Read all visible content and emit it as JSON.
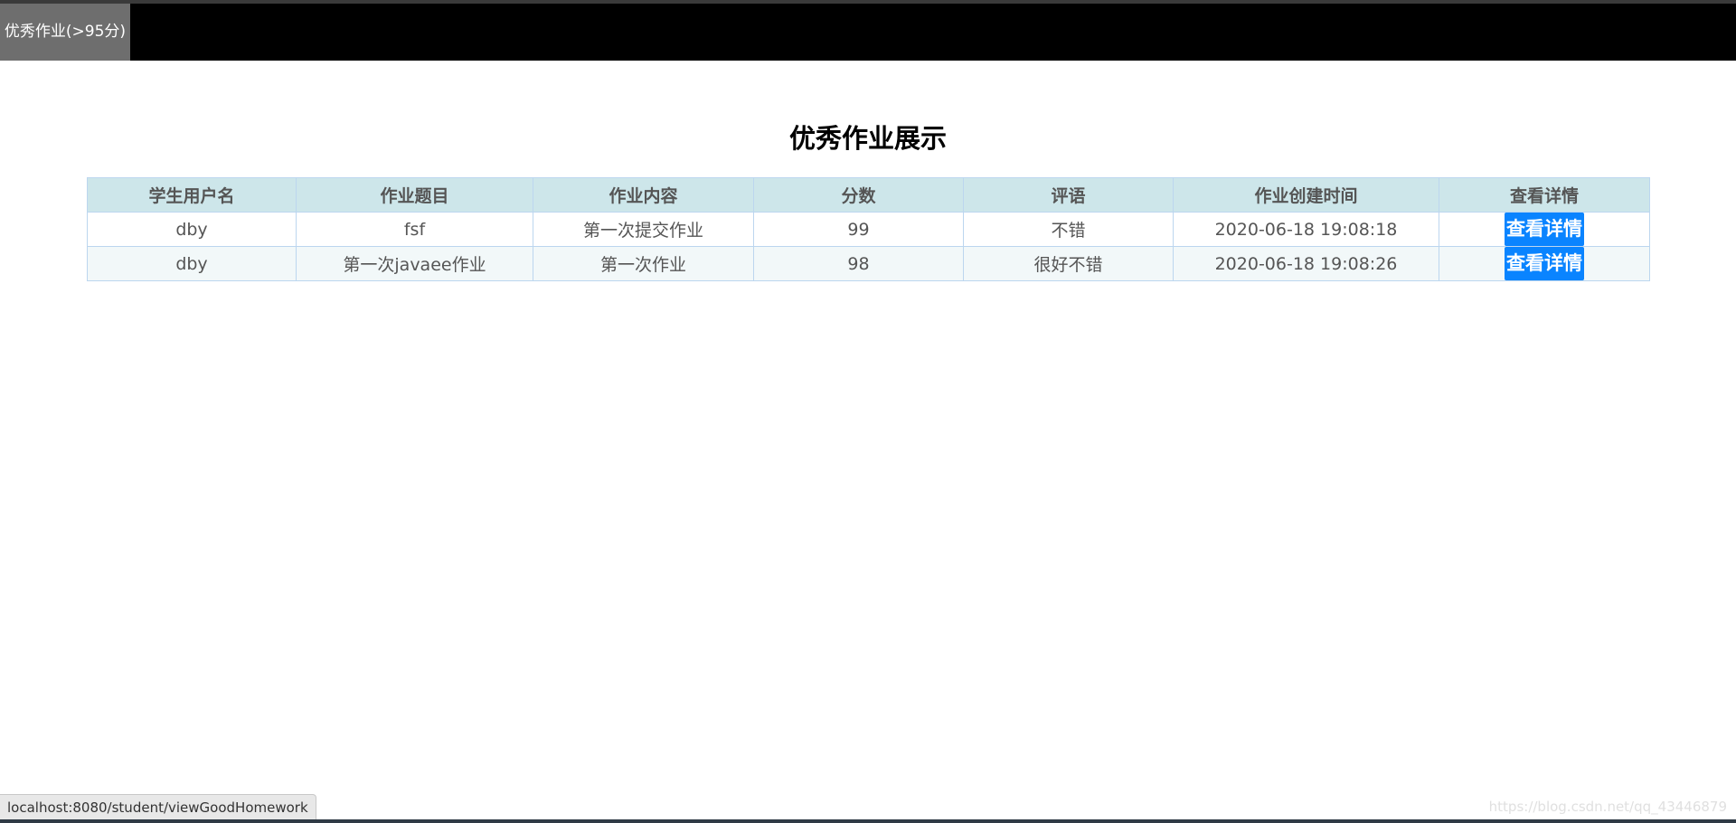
{
  "nav": {
    "tab_label": "优秀作业(>95分)"
  },
  "page": {
    "title": "优秀作业展示"
  },
  "table": {
    "headers": [
      "学生用户名",
      "作业题目",
      "作业内容",
      "分数",
      "评语",
      "作业创建时间",
      "查看详情"
    ],
    "rows": [
      {
        "username": "dby",
        "homework_title": "fsf",
        "content": "第一次提交作业",
        "score": "99",
        "comment": "不错",
        "created_at": "2020-06-18 19:08:18",
        "action": "查看详情"
      },
      {
        "username": "dby",
        "homework_title": "第一次javaee作业",
        "content": "第一次作业",
        "score": "98",
        "comment": "很好不错",
        "created_at": "2020-06-18 19:08:26",
        "action": "查看详情"
      }
    ]
  },
  "status_bar": {
    "url": "localhost:8080/student/viewGoodHomework"
  },
  "watermark": "https://blog.csdn.net/qq_43446879",
  "colors": {
    "header_bg": "#cde6ea",
    "button_bg": "#0a84ff",
    "navbar_bg": "#000000",
    "nav_tab_bg": "#6e6e6e"
  }
}
